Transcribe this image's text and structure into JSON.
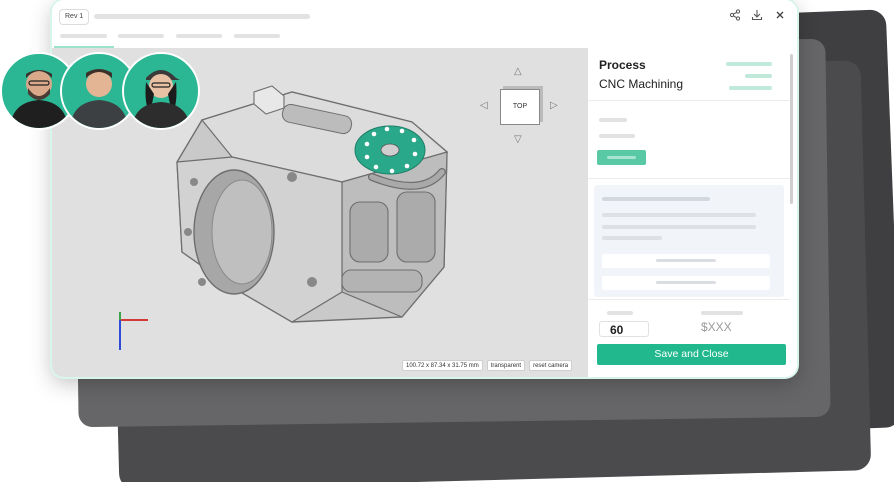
{
  "window": {
    "rev_badge": "Rev 1"
  },
  "viewer": {
    "nav_cube_label": "TOP",
    "dimensions": "100.72 x 87.34 x 31.75 mm",
    "transparent_label": "transparent",
    "reset_camera_label": "reset camera"
  },
  "panel": {
    "process_label": "Process",
    "process_value": "CNC Machining",
    "quantity_value": "60",
    "price_placeholder": "$XXX",
    "save_close_label": "Save and Close"
  },
  "icons": {
    "share": "share-icon",
    "download": "download-icon",
    "close": "close-icon"
  },
  "colors": {
    "accent": "#21b88d",
    "avatar_bg": "#2bb694",
    "part_feature": "#2aa88a"
  }
}
